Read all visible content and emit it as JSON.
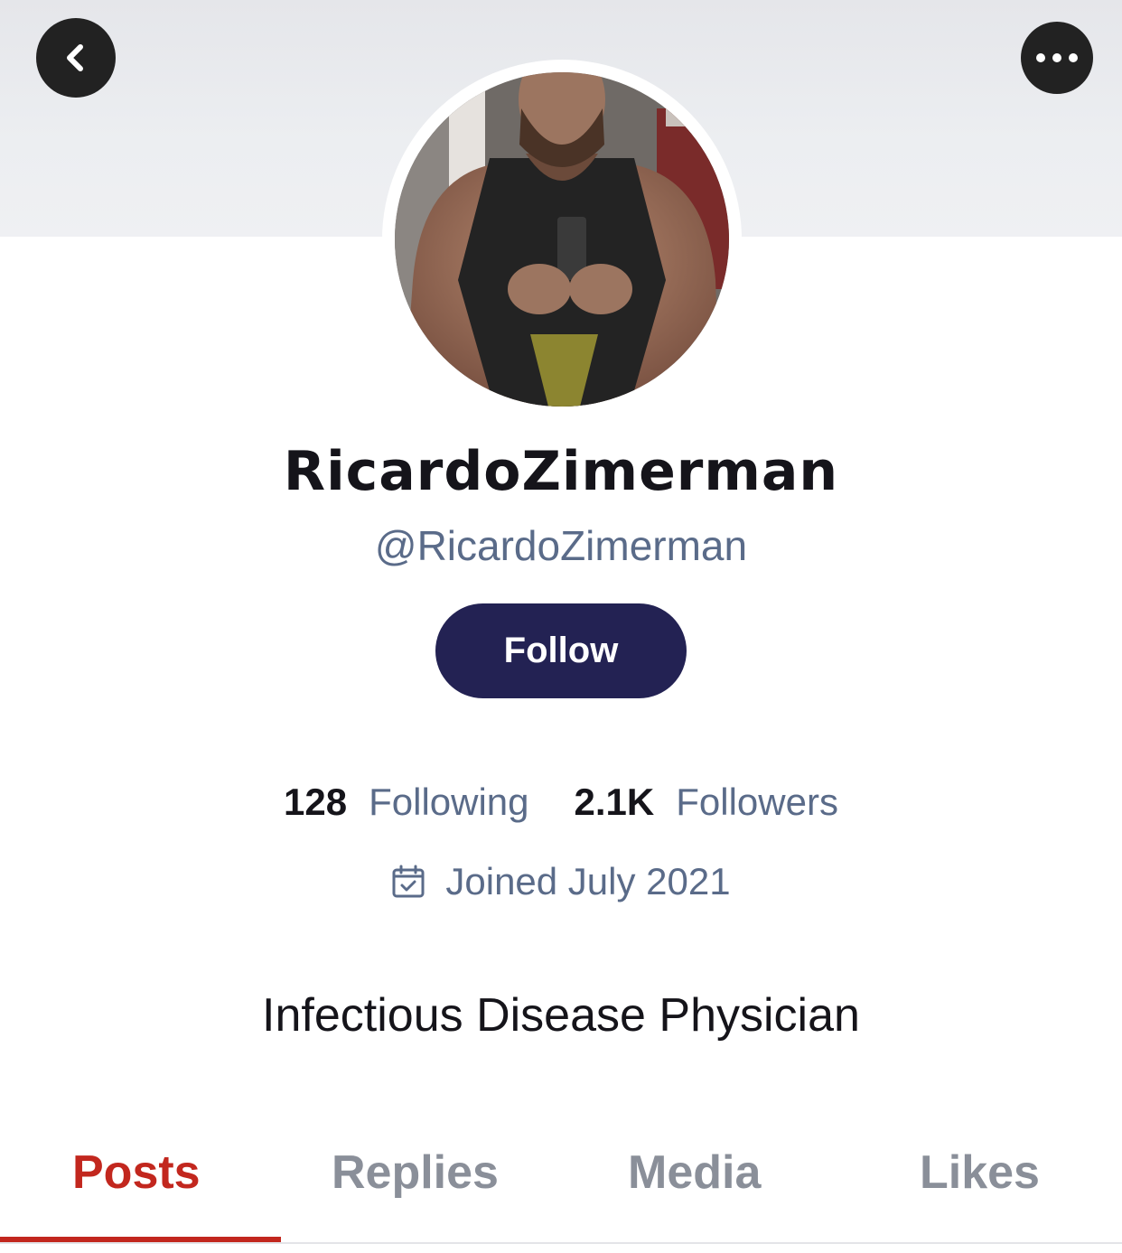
{
  "header": {
    "back_icon": "chevron-left-icon",
    "more_icon": "ellipsis-icon"
  },
  "profile": {
    "display_name": "RicardoZimerman",
    "handle": "@RicardoZimerman",
    "follow_label": "Follow",
    "following_count": "128",
    "following_label": "Following",
    "followers_count": "2.1K",
    "followers_label": "Followers",
    "joined_icon": "calendar-check-icon",
    "joined_text": "Joined July 2021",
    "bio": "Infectious Disease Physician"
  },
  "tabs": [
    {
      "label": "Posts",
      "active": true
    },
    {
      "label": "Replies",
      "active": false
    },
    {
      "label": "Media",
      "active": false
    },
    {
      "label": "Likes",
      "active": false
    }
  ],
  "colors": {
    "follow_button": "#232253",
    "active_tab": "#c2271e",
    "secondary_text": "#5a6b89",
    "inactive_tab": "#8a8f99"
  }
}
